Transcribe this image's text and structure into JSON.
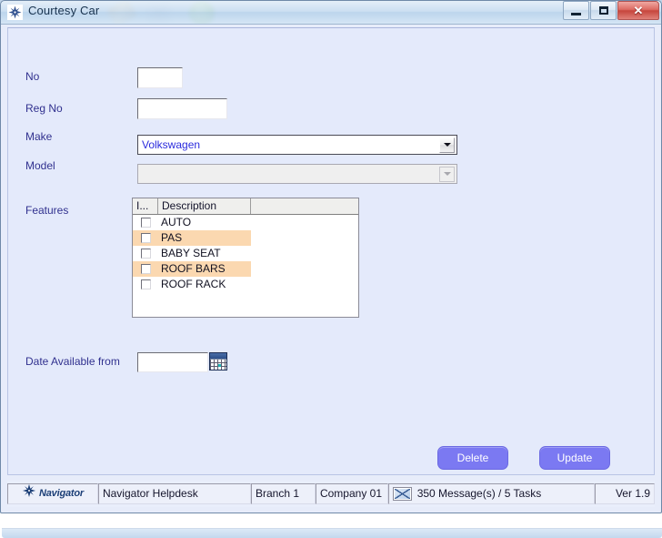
{
  "window": {
    "title": "Courtesy Car",
    "icon": "compass-star-icon",
    "minimize_label": "",
    "maximize_label": "",
    "close_label": "✕"
  },
  "form": {
    "fields": [
      {
        "label": "No",
        "value": "",
        "type": "text"
      },
      {
        "label": "Reg No",
        "value": "",
        "type": "text"
      },
      {
        "label": "Make",
        "value": "Volkswagen",
        "type": "combo",
        "enabled": true
      },
      {
        "label": "Model",
        "value": "",
        "type": "combo",
        "enabled": false
      },
      {
        "label": "Features",
        "value": "",
        "type": "grid"
      },
      {
        "label": "Date Available from",
        "value": "",
        "type": "date"
      }
    ],
    "features_grid": {
      "columns": [
        "I...",
        "Description",
        ""
      ],
      "rows": [
        {
          "checked": false,
          "description": "AUTO",
          "highlighted": false
        },
        {
          "checked": false,
          "description": "PAS",
          "highlighted": true
        },
        {
          "checked": false,
          "description": "BABY SEAT",
          "highlighted": false
        },
        {
          "checked": false,
          "description": "ROOF BARS",
          "highlighted": true
        },
        {
          "checked": false,
          "description": "ROOF RACK",
          "highlighted": false
        }
      ],
      "highlight_color": "#fbd8b0"
    },
    "calendar_button_icon": "calendar-icon"
  },
  "actions": {
    "delete_label": "Delete",
    "update_label": "Update",
    "button_color": "#7b79f2"
  },
  "statusbar": {
    "logo_text": "Navigator",
    "logo_icon": "compass-star-icon",
    "helpdesk": "Navigator Helpdesk",
    "branch": "Branch 1",
    "company": "Company 01",
    "mail_icon": "envelope-icon",
    "messages": "350 Message(s) / 5 Tasks",
    "version": "Ver 1.9"
  }
}
